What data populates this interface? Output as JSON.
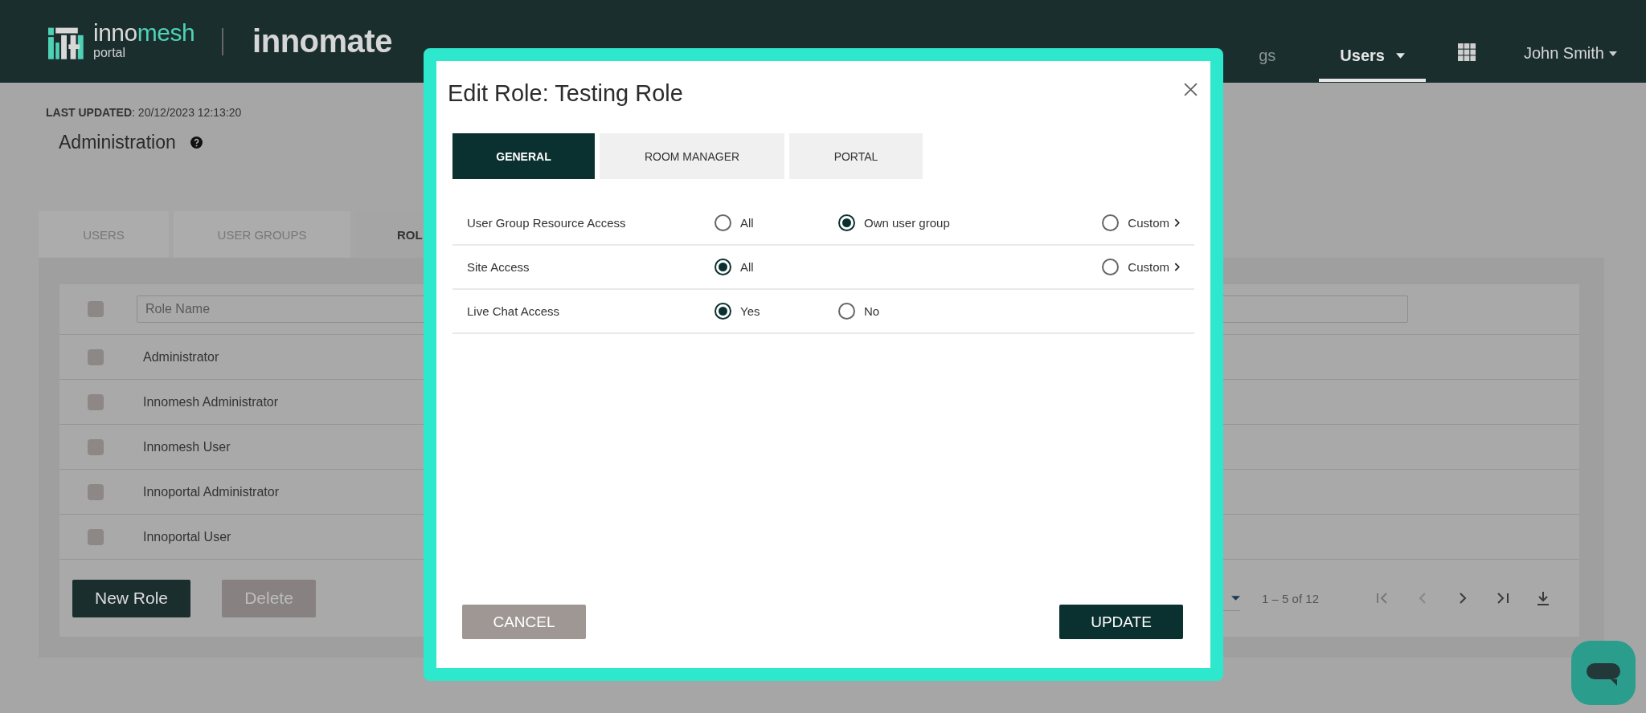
{
  "header": {
    "logo": {
      "name_a": "inno",
      "name_b": "mesh",
      "sub": "portal",
      "product": "innomate"
    },
    "nav": [
      {
        "label": "gs",
        "selected": false
      },
      {
        "label": "Users",
        "selected": true,
        "has_menu": true
      }
    ],
    "user": "John Smith"
  },
  "last_updated": {
    "label": "LAST UPDATED",
    "value": ": 20/12/2023 12:13:20"
  },
  "page_title": "Administration",
  "tabs": [
    {
      "label": "USERS",
      "selected": false
    },
    {
      "label": "USER GROUPS",
      "selected": false
    },
    {
      "label": "ROL",
      "selected": true
    }
  ],
  "table": {
    "all_checked": false,
    "filter": {
      "placeholder": "Role Name"
    },
    "rows": [
      {
        "name": "Administrator",
        "checked": false
      },
      {
        "name": "Innomesh Administrator",
        "checked": false
      },
      {
        "name": "Innomesh User",
        "checked": false
      },
      {
        "name": "Innoportal Administrator",
        "checked": false
      },
      {
        "name": "Innoportal User",
        "checked": false
      }
    ]
  },
  "actions": [
    {
      "label": "New Role",
      "disabled": false
    },
    {
      "label": "Delete",
      "disabled": true
    }
  ],
  "pagination": {
    "range": "1 – 5 of 12"
  },
  "dialog": {
    "title": "Edit Role: Testing Role",
    "tabs": [
      {
        "label": "GENERAL",
        "selected": true
      },
      {
        "label": "ROOM MANAGER",
        "selected": false
      },
      {
        "label": "PORTAL",
        "selected": false
      }
    ],
    "settings": [
      {
        "label": "User Group Resource Access",
        "options": [
          {
            "label": "All",
            "kind": "plain",
            "selected": false
          },
          {
            "label": "Own user group",
            "kind": "plain",
            "selected": true
          },
          {
            "label": "Custom",
            "kind": "custom",
            "selected": false
          }
        ]
      },
      {
        "label": "Site Access",
        "options": [
          {
            "label": "All",
            "kind": "plain",
            "selected": true
          },
          {
            "label": "Custom",
            "kind": "custom",
            "selected": false
          }
        ]
      },
      {
        "label": "Live Chat Access",
        "options": [
          {
            "label": "Yes",
            "kind": "plain",
            "selected": true
          },
          {
            "label": "No",
            "kind": "plain",
            "selected": false
          }
        ]
      }
    ],
    "buttons": [
      {
        "label": "CANCEL",
        "kind": "secondary"
      },
      {
        "label": "UPDATE",
        "kind": "primary"
      }
    ]
  }
}
